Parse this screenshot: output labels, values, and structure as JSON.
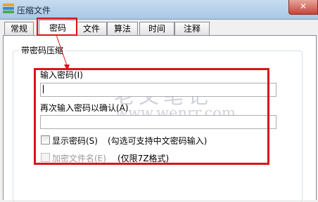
{
  "window": {
    "title": "压缩文件",
    "close_glyph": "✕"
  },
  "tabs": [
    {
      "label": "常规"
    },
    {
      "label": "密码"
    },
    {
      "label": "文件"
    },
    {
      "label": "算法"
    },
    {
      "label": "时间"
    },
    {
      "label": "注释"
    }
  ],
  "group": {
    "title": "带密码压缩"
  },
  "password": {
    "label": "输入密码(I)",
    "value": ""
  },
  "confirm": {
    "label": "再次输入密码以确认(A)",
    "value": ""
  },
  "show_password": {
    "label": "显示密码(S)",
    "hint": "(勾选可支持中文密码输入)",
    "checked": false
  },
  "encrypt_filenames": {
    "label": "加密文件名(E)",
    "hint": "(仅限7Z格式)",
    "checked": false,
    "enabled": false
  },
  "watermark": {
    "title": "老文笔记",
    "url": "www.wenrr.com"
  },
  "colors": {
    "highlight": "#d8151b",
    "titlebar": "#b6d0ea"
  }
}
